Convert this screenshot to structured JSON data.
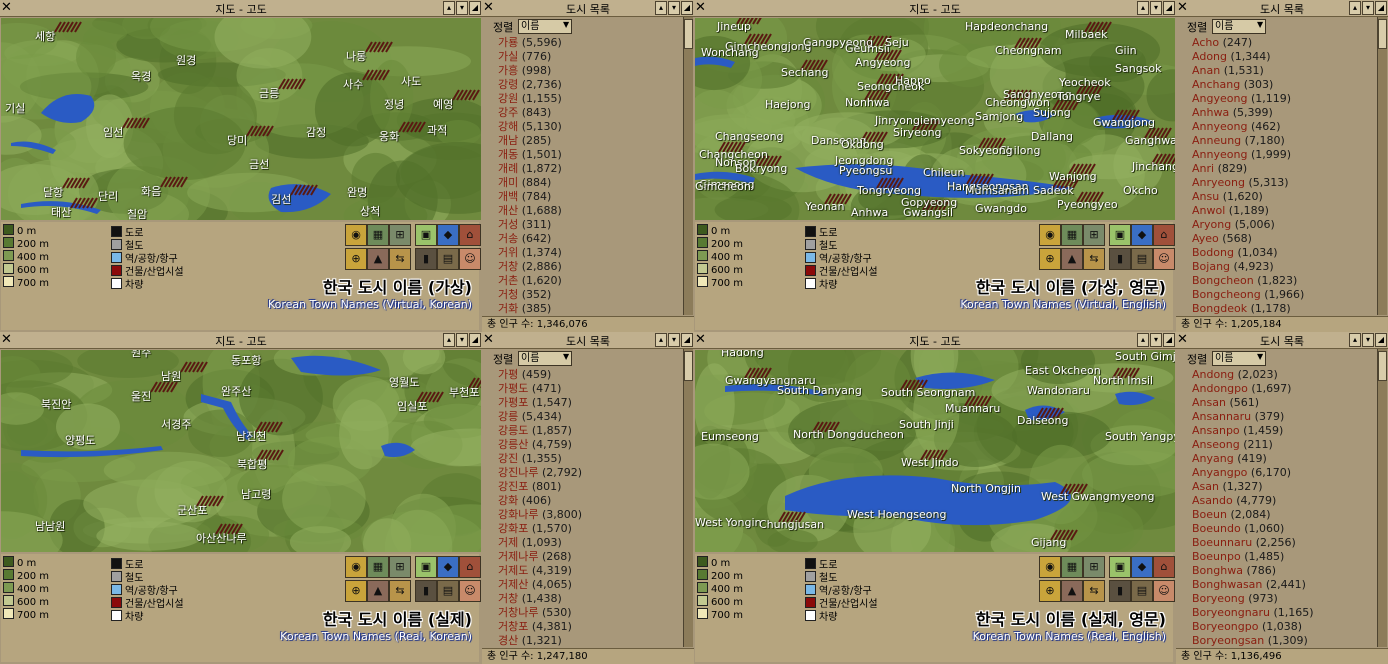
{
  "map_window_title": "지도 - 고도",
  "list_window_title": "도시 목록",
  "sort_label": "정렬",
  "sort_value": "이름",
  "legend": {
    "heights": [
      "0 m",
      "200 m",
      "400 m",
      "600 m",
      "700 m"
    ],
    "height_colors": [
      "#3d5a1e",
      "#587a32",
      "#7d9a52",
      "#c2c890",
      "#f0e8b8"
    ],
    "keys": [
      "도로",
      "철도",
      "역/공항/항구",
      "건물/산업시설",
      "차량"
    ],
    "key_colors": [
      "#111111",
      "#a0a0a0",
      "#7ab8e6",
      "#8a0a0a",
      "#ffffff"
    ]
  },
  "colors": {
    "map_green": "#6f8a3e",
    "water": "#2a5bc4",
    "panel": "#b6a57f",
    "list_name": "#8a1e10"
  },
  "panels": [
    {
      "caption_ko": "한국 도시 이름 (가상)",
      "caption_en": "Korean Town Names (Virtual, Korean)",
      "total_label": "총 인구 수:",
      "total_value": "1,346,076",
      "map_labels": [
        "세항",
        "원경",
        "나롱",
        "옥경",
        "사수",
        "사도",
        "금릉",
        "정녕",
        "예영",
        "기실",
        "임선",
        "감정",
        "옹화",
        "과적",
        "당미",
        "금선",
        "달항",
        "단리",
        "화음",
        "완명",
        "태산",
        "칠암",
        "김선",
        "상척"
      ],
      "towns": [
        {
          "name": "가룡",
          "pop": "(5,596)"
        },
        {
          "name": "가실",
          "pop": "(776)"
        },
        {
          "name": "가흥",
          "pop": "(998)"
        },
        {
          "name": "강령",
          "pop": "(2,736)"
        },
        {
          "name": "강원",
          "pop": "(1,155)"
        },
        {
          "name": "강주",
          "pop": "(843)"
        },
        {
          "name": "강해",
          "pop": "(5,130)"
        },
        {
          "name": "개남",
          "pop": "(285)"
        },
        {
          "name": "개동",
          "pop": "(1,501)"
        },
        {
          "name": "개례",
          "pop": "(1,872)"
        },
        {
          "name": "개미",
          "pop": "(884)"
        },
        {
          "name": "개백",
          "pop": "(784)"
        },
        {
          "name": "개산",
          "pop": "(1,688)"
        },
        {
          "name": "거성",
          "pop": "(311)"
        },
        {
          "name": "거송",
          "pop": "(642)"
        },
        {
          "name": "거위",
          "pop": "(1,374)"
        },
        {
          "name": "거창",
          "pop": "(2,886)"
        },
        {
          "name": "거촌",
          "pop": "(1,620)"
        },
        {
          "name": "거청",
          "pop": "(352)"
        },
        {
          "name": "거화",
          "pop": "(385)"
        }
      ]
    },
    {
      "caption_ko": "한국 도시 이름 (가상, 영문)",
      "caption_en": "Korean Town Names (Virtual, English)",
      "total_label": "총 인구 수:",
      "total_value": "1,205,184",
      "map_labels": [
        "Jineup",
        "Hapdeonchang",
        "Gimcheongjong",
        "Gangpyeong",
        "Geumsil",
        "Seju",
        "Milbaek",
        "Wonchang",
        "Cheongnam",
        "Giin",
        "Angyeong",
        "Sangsok",
        "Sechang",
        "Happo",
        "Seongcheok",
        "Yeocheok",
        "Nonhwa",
        "Sangnyeong",
        "Tongrye",
        "Haejong",
        "Cheongwon",
        "Samjong",
        "Sujong",
        "Jinryongiemyeong",
        "Gwangjong",
        "Changseong",
        "Siryeong",
        "Dallang",
        "Ganghwa",
        "Danseong",
        "Okdong",
        "Chilong",
        "Changcheon",
        "Jeongdong",
        "Sokyeong",
        "Nonson",
        "Bokryong",
        "Pyeongsu",
        "Jinchang",
        "Chileun",
        "Wanjong",
        "Gimseong",
        "Hangseongsan",
        "Gimcheon",
        "Tongryeong",
        "Mumsanam",
        "Sadeok",
        "Okcho",
        "Yeonan",
        "Gopyeong",
        "Pyeongyeo",
        "Anhwa",
        "Gwangsil",
        "Gwangdo"
      ],
      "towns": [
        {
          "name": "Acho",
          "pop": "(247)"
        },
        {
          "name": "Adong",
          "pop": "(1,344)"
        },
        {
          "name": "Anan",
          "pop": "(1,531)"
        },
        {
          "name": "Anchang",
          "pop": "(303)"
        },
        {
          "name": "Angyeong",
          "pop": "(1,119)"
        },
        {
          "name": "Anhwa",
          "pop": "(5,399)"
        },
        {
          "name": "Annyeong",
          "pop": "(462)"
        },
        {
          "name": "Anneung",
          "pop": "(7,180)"
        },
        {
          "name": "Annyeong",
          "pop": "(1,999)"
        },
        {
          "name": "Anri",
          "pop": "(829)"
        },
        {
          "name": "Anryeong",
          "pop": "(5,313)"
        },
        {
          "name": "Ansu",
          "pop": "(1,620)"
        },
        {
          "name": "Anwol",
          "pop": "(1,189)"
        },
        {
          "name": "Aryong",
          "pop": "(5,006)"
        },
        {
          "name": "Ayeo",
          "pop": "(568)"
        },
        {
          "name": "Bodong",
          "pop": "(1,034)"
        },
        {
          "name": "Bojang",
          "pop": "(4,923)"
        },
        {
          "name": "Bongcheon",
          "pop": "(1,823)"
        },
        {
          "name": "Bongcheong",
          "pop": "(1,966)"
        },
        {
          "name": "Bongdeok",
          "pop": "(1,178)"
        }
      ]
    },
    {
      "caption_ko": "한국 도시 이름 (실제)",
      "caption_en": "Korean Town Names (Real, Korean)",
      "total_label": "총 인구 수:",
      "total_value": "1,247,180",
      "map_labels": [
        "원주",
        "동포항",
        "남원",
        "영월도",
        "부천포",
        "완주산",
        "울진",
        "북진안",
        "임실포",
        "서경주",
        "남진천",
        "양평도",
        "북합평",
        "남고령",
        "군산포",
        "남남원",
        "아산산나루"
      ],
      "towns": [
        {
          "name": "가평",
          "pop": "(459)"
        },
        {
          "name": "가평도",
          "pop": "(471)"
        },
        {
          "name": "가평포",
          "pop": "(1,547)"
        },
        {
          "name": "강릉",
          "pop": "(5,434)"
        },
        {
          "name": "강릉도",
          "pop": "(1,857)"
        },
        {
          "name": "강릉산",
          "pop": "(4,759)"
        },
        {
          "name": "강진",
          "pop": "(1,355)"
        },
        {
          "name": "강진나루",
          "pop": "(2,792)"
        },
        {
          "name": "강진포",
          "pop": "(801)"
        },
        {
          "name": "강화",
          "pop": "(406)"
        },
        {
          "name": "강화나루",
          "pop": "(3,800)"
        },
        {
          "name": "강화포",
          "pop": "(1,570)"
        },
        {
          "name": "거제",
          "pop": "(1,093)"
        },
        {
          "name": "거제나루",
          "pop": "(268)"
        },
        {
          "name": "거제도",
          "pop": "(4,319)"
        },
        {
          "name": "거제산",
          "pop": "(4,065)"
        },
        {
          "name": "거창",
          "pop": "(1,438)"
        },
        {
          "name": "거창나루",
          "pop": "(530)"
        },
        {
          "name": "거창포",
          "pop": "(4,381)"
        },
        {
          "name": "경산",
          "pop": "(1,321)"
        }
      ]
    },
    {
      "caption_ko": "한국 도시 이름 (실제, 영문)",
      "caption_en": "Korean Town Names (Real, English)",
      "total_label": "총 인구 수:",
      "total_value": "1,136,496",
      "map_labels": [
        "Hadong",
        "South Gimje",
        "Gwangyangnaru",
        "East Okcheon",
        "North Imsil",
        "South Danyang",
        "South Seongnam",
        "Wandonaru",
        "Muannaru",
        "South Jinji",
        "Dalseong",
        "Eumseong",
        "North Dongducheon",
        "South Yangpyeong",
        "West Jindo",
        "North Ongjin",
        "West Gwangmyeong",
        "West Yongin",
        "Chungjusan",
        "West Hoengseong",
        "Gijang"
      ],
      "towns": [
        {
          "name": "Andong",
          "pop": "(2,023)"
        },
        {
          "name": "Andongpo",
          "pop": "(1,697)"
        },
        {
          "name": "Ansan",
          "pop": "(561)"
        },
        {
          "name": "Ansannaru",
          "pop": "(379)"
        },
        {
          "name": "Ansanpo",
          "pop": "(1,459)"
        },
        {
          "name": "Anseong",
          "pop": "(211)"
        },
        {
          "name": "Anyang",
          "pop": "(419)"
        },
        {
          "name": "Anyangpo",
          "pop": "(6,170)"
        },
        {
          "name": "Asan",
          "pop": "(1,327)"
        },
        {
          "name": "Asando",
          "pop": "(4,779)"
        },
        {
          "name": "Boeun",
          "pop": "(2,084)"
        },
        {
          "name": "Boeundo",
          "pop": "(1,060)"
        },
        {
          "name": "Boeunnaru",
          "pop": "(2,256)"
        },
        {
          "name": "Boeunpo",
          "pop": "(1,485)"
        },
        {
          "name": "Bonghwa",
          "pop": "(786)"
        },
        {
          "name": "Bonghwasan",
          "pop": "(2,441)"
        },
        {
          "name": "Boryeong",
          "pop": "(973)"
        },
        {
          "name": "Boryeongnaru",
          "pop": "(1,165)"
        },
        {
          "name": "Boryeongpo",
          "pop": "(1,038)"
        },
        {
          "name": "Boryeongsan",
          "pop": "(1,309)"
        }
      ]
    }
  ]
}
